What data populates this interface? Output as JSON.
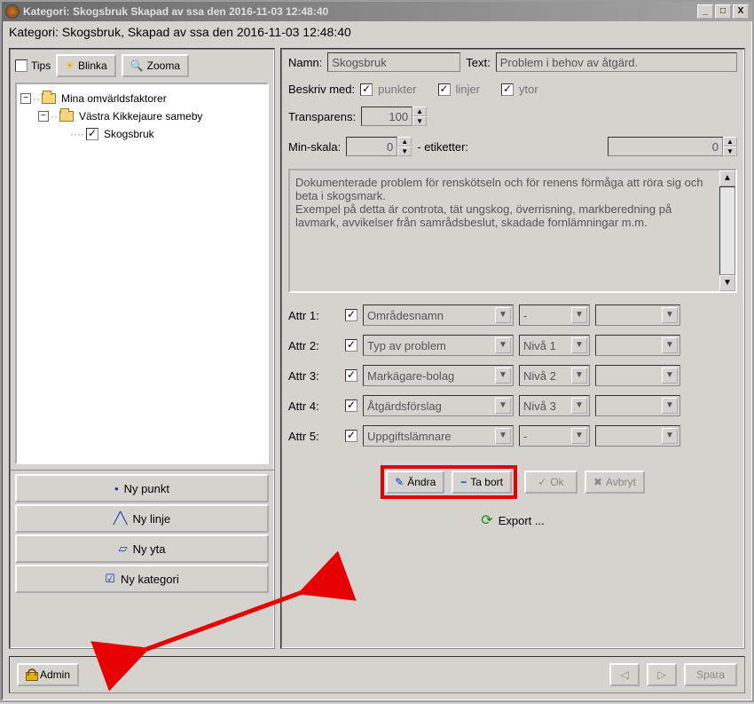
{
  "window": {
    "title": "Kategori: Skogsbruk Skapad av ssa den 2016-11-03 12:48:40",
    "subheader": "Kategori: Skogsbruk, Skapad av ssa den 2016-11-03 12:48:40",
    "min_label": "_",
    "max_label": "□",
    "close_label": "X"
  },
  "toolbar": {
    "tips": "Tips",
    "blinka": "Blinka",
    "zooma": "Zooma"
  },
  "tree": {
    "root": "Mina omvärldsfaktorer",
    "child1": "Västra Kikkejaure sameby",
    "leaf1": "Skogsbruk"
  },
  "newbuttons": {
    "punkt": "Ny punkt",
    "linje": "Ny linje",
    "yta": "Ny yta",
    "kategori": "Ny kategori"
  },
  "form": {
    "namn_label": "Namn:",
    "namn_value": "Skogsbruk",
    "text_label": "Text:",
    "text_value": "Problem i behov av åtgärd.",
    "beskriv_label": "Beskriv med:",
    "punkter": "punkter",
    "linjer": "linjer",
    "ytor": "ytor",
    "transparens_label": "Transparens:",
    "transparens_value": "100",
    "minskala_label": "Min-skala:",
    "minskala_value": "0",
    "etiketter_label": "- etiketter:",
    "etiketter_value": "0",
    "description": "Dokumenterade problem för renskötseln och för renens förmåga att röra sig och beta i skogsmark.\nExempel på detta är controta, tät ungskog, överrisning, markberedning på lavmark, avvikelser från samrådsbeslut, skadade fornlämningar m.m."
  },
  "attrs": [
    {
      "label": "Attr 1:",
      "name": "Områdesnamn",
      "level": "-"
    },
    {
      "label": "Attr 2:",
      "name": "Typ av problem",
      "level": "Nivå 1"
    },
    {
      "label": "Attr 3:",
      "name": "Markägare-bolag",
      "level": "Nivå 2"
    },
    {
      "label": "Attr 4:",
      "name": "Åtgärdsförslag",
      "level": "Nivå 3"
    },
    {
      "label": "Attr 5:",
      "name": "Uppgiftslämnare",
      "level": "-"
    }
  ],
  "actionbuttons": {
    "andra": "Ändra",
    "tabort": "Ta bort",
    "ok": "Ok",
    "avbryt": "Avbryt",
    "export": "Export ..."
  },
  "bottombar": {
    "admin": "Admin",
    "spara": "Spara"
  }
}
